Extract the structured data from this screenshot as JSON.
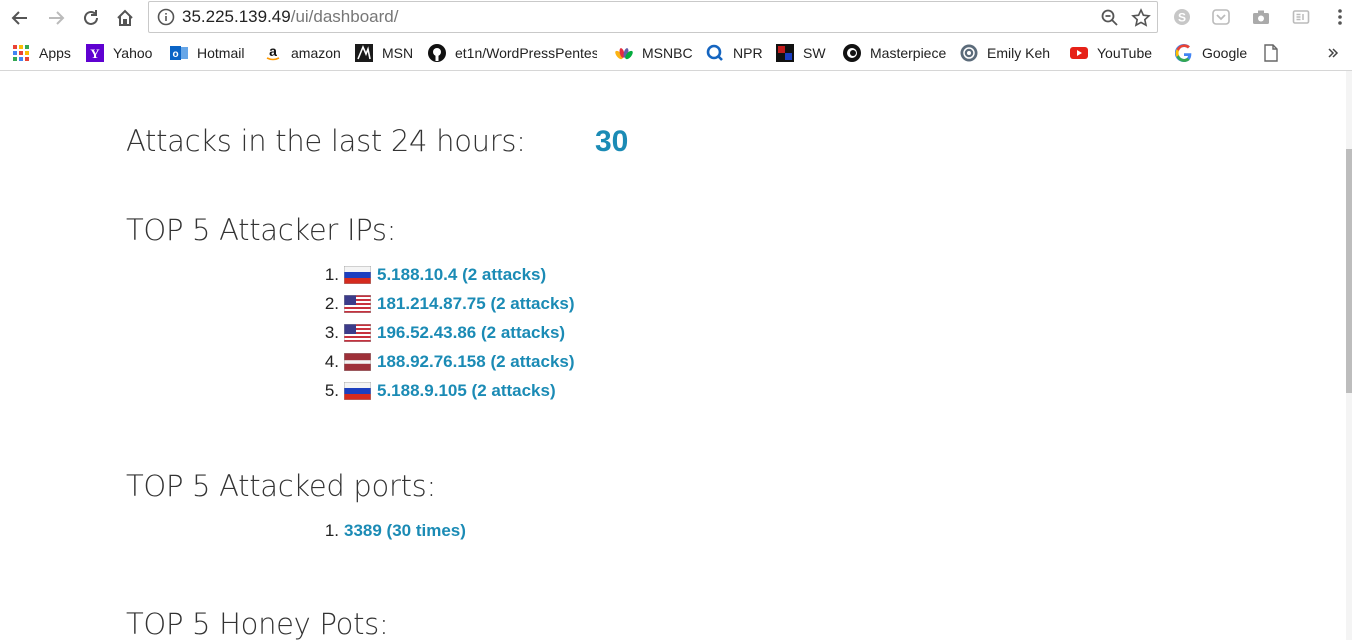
{
  "browser": {
    "url_host": "35.225.139.49",
    "url_path": "/ui/dashboard/"
  },
  "bookmarks": [
    {
      "label": "Apps",
      "icon": "apps-grid-icon"
    },
    {
      "label": "Yahoo",
      "icon": "yahoo-icon"
    },
    {
      "label": "Hotmail",
      "icon": "outlook-icon"
    },
    {
      "label": "amazon",
      "icon": "amazon-icon"
    },
    {
      "label": "MSN",
      "icon": "msn-icon"
    },
    {
      "label": "et1n/WordPressPentest",
      "icon": "github-icon"
    },
    {
      "label": "MSNBC",
      "icon": "nbc-peacock-icon"
    },
    {
      "label": "NPR",
      "icon": "npr-icon"
    },
    {
      "label": "SW",
      "icon": "sw-icon"
    },
    {
      "label": "Masterpiece",
      "icon": "pbs-icon"
    },
    {
      "label": "Emily Keh",
      "icon": "emily-icon"
    },
    {
      "label": "YouTube",
      "icon": "youtube-icon"
    },
    {
      "label": "Google",
      "icon": "google-icon"
    }
  ],
  "dashboard": {
    "attacks_label": "Attacks in the last 24 hours:",
    "attacks_count": "30",
    "top_ips_heading": "TOP 5 Attacker IPs:",
    "top_ips": [
      {
        "num": "1.",
        "flag": "ru",
        "text": "5.188.10.4 (2 attacks)"
      },
      {
        "num": "2.",
        "flag": "us",
        "text": "181.214.87.75 (2 attacks)"
      },
      {
        "num": "3.",
        "flag": "us",
        "text": "196.52.43.86 (2 attacks)"
      },
      {
        "num": "4.",
        "flag": "lv",
        "text": "188.92.76.158 (2 attacks)"
      },
      {
        "num": "5.",
        "flag": "ru",
        "text": "5.188.9.105 (2 attacks)"
      }
    ],
    "top_ports_heading": "TOP 5 Attacked ports:",
    "top_ports": [
      {
        "num": "1.",
        "text": "3389 (30 times)"
      }
    ],
    "honeypots_heading": "TOP 5 Honey Pots:"
  },
  "colors": {
    "link": "#1b8bb5",
    "heading": "#333333"
  }
}
